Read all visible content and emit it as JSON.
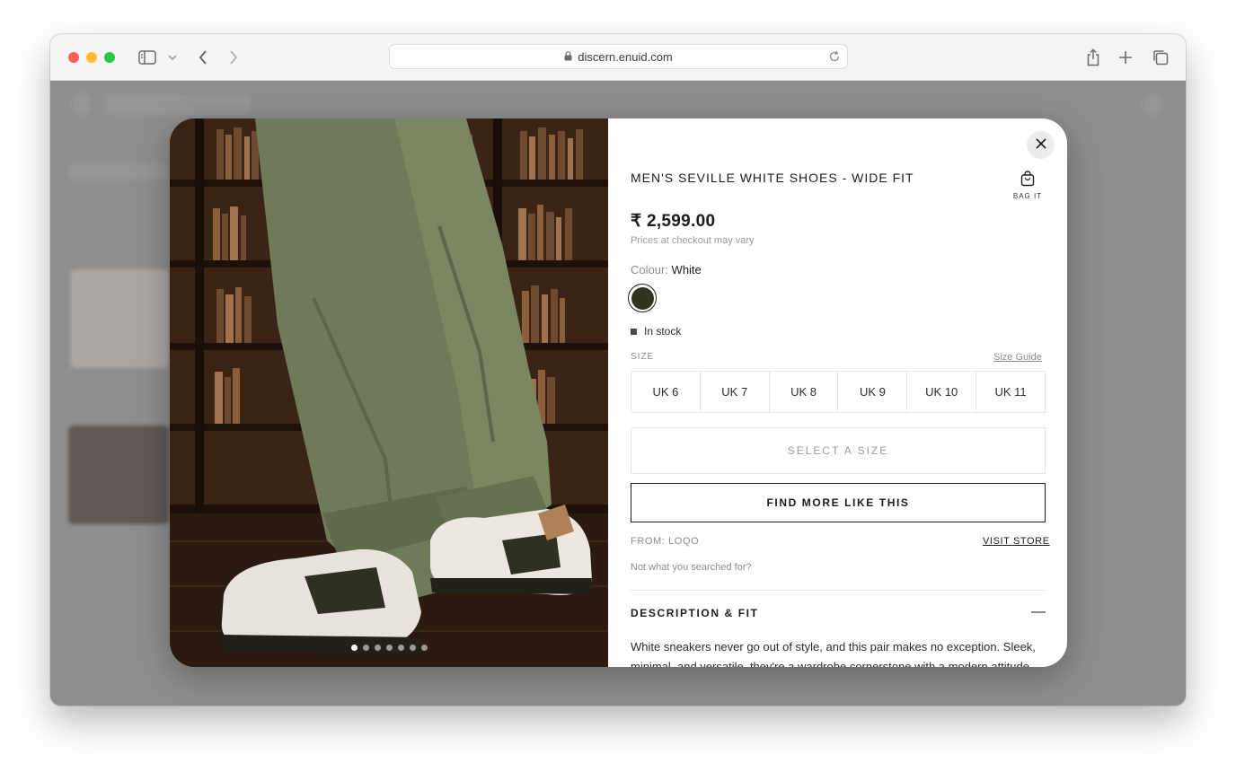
{
  "browser": {
    "url": "discern.enuid.com"
  },
  "product": {
    "title": "MEN'S SEVILLE WHITE SHOES - WIDE FIT",
    "bag_label": "BAG IT",
    "price": "₹ 2,599.00",
    "price_note": "Prices at checkout may vary",
    "colour_label": "Colour:",
    "colour_value": "White",
    "swatch_color": "#34351f",
    "stock": "In stock",
    "size_label": "SIZE",
    "size_guide": "Size Guide",
    "sizes": [
      "UK 6",
      "UK 7",
      "UK 8",
      "UK 9",
      "UK 10",
      "UK 11"
    ],
    "select_size": "SELECT A SIZE",
    "find_more": "FIND MORE LIKE THIS",
    "from": "FROM: LOQO",
    "visit_store": "VISIT STORE",
    "not_what": "Not what you searched for?",
    "description_heading": "DESCRIPTION & FIT",
    "description_toggle": "—",
    "description": "White sneakers never go out of style, and this pair makes no exception. Sleek, minimal, and versatile, they're a wardrobe cornerstone with a modern attitude."
  },
  "gallery": {
    "image_count": 7,
    "active_index": 0
  },
  "icons": {
    "close": "close-icon",
    "bag": "bag-icon",
    "lock": "lock-icon",
    "reload": "reload-icon",
    "share": "share-icon",
    "new_tab": "plus-icon",
    "tabs": "tabs-overview-icon",
    "sidebar": "sidebar-icon",
    "back": "chevron-left-icon",
    "forward": "chevron-right-icon"
  }
}
